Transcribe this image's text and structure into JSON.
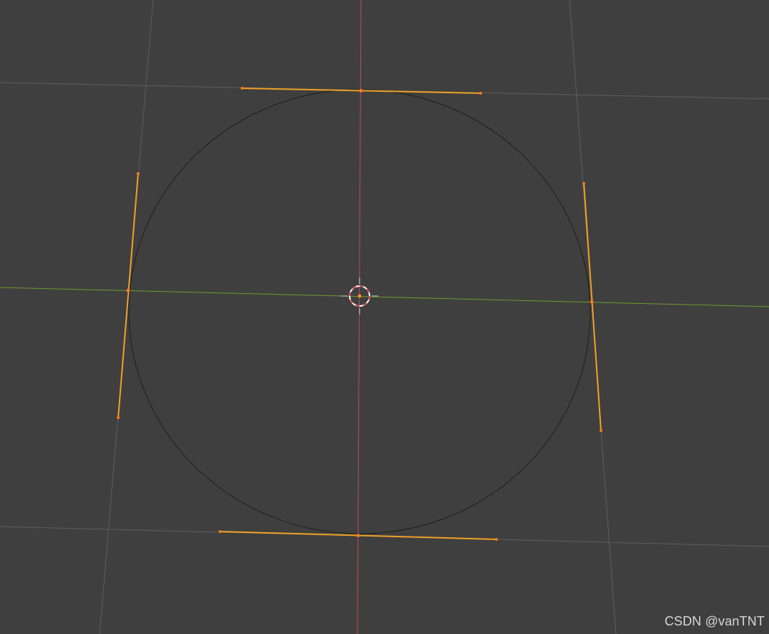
{
  "viewport": {
    "background": "#3f3f3f",
    "colors": {
      "grid": "#5e5e5e",
      "x_axis": "#c24a57",
      "y_axis": "#6f9a2f",
      "curve": "#1e1e1e",
      "handle": "#f0a126",
      "handle_point": "#ff7a1a",
      "cursor_red": "#d94a4a",
      "cursor_white": "#ffffff"
    }
  },
  "object": {
    "type": "bezier-circle",
    "mode": "edit",
    "selected": true,
    "control_points": 4
  },
  "icons": {
    "cursor": "3d-cursor-icon"
  },
  "watermark": {
    "text": "CSDN @vanTNT"
  }
}
